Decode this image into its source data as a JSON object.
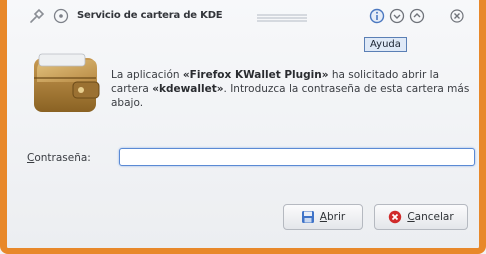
{
  "window": {
    "title": "Servicio de cartera de KDE"
  },
  "tooltip": {
    "help": "Ayuda"
  },
  "message": {
    "part1": "La aplicación ",
    "app": "«Firefox KWallet Plugin»",
    "part2": " ha solicitado abrir la cartera ",
    "wallet": "«kdewallet»",
    "part3": ". Introduzca la contraseña de esta cartera más abajo."
  },
  "password": {
    "label_first": "C",
    "label_rest": "ontraseña:",
    "value": ""
  },
  "buttons": {
    "open_first": "A",
    "open_rest": "brir",
    "cancel_first": "C",
    "cancel_rest": "ancelar"
  },
  "colors": {
    "frame": "#e8882a",
    "focus": "#5b8ad4",
    "cancel_icon": "#d02a2a"
  }
}
